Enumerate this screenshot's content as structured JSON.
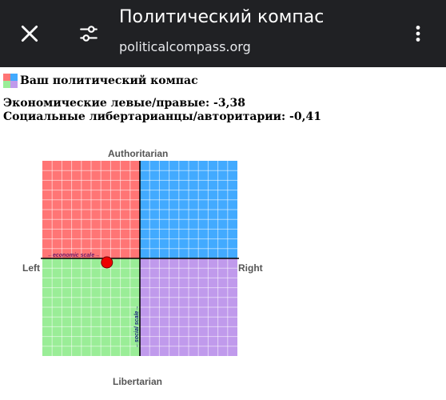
{
  "header": {
    "title": "Политический компас",
    "url": "politicalcompass.org"
  },
  "content": {
    "heading": "Ваш политический компас",
    "economic_line": "Экономические левые/правые: -3,38",
    "social_line": "Социальные либертарианцы/авторитарии: -0,41"
  },
  "compass": {
    "label_top": "Authoritarian",
    "label_bottom": "Libertarian",
    "label_left": "Left",
    "label_right": "Right",
    "economic_scale": "←economic scale→",
    "social_scale": "←social scale→",
    "economic_value": -3.38,
    "social_value": -0.41,
    "range": [
      -10,
      10
    ],
    "colors": {
      "top_left": "#ff7575",
      "top_right": "#42aaff",
      "bottom_left": "#9aed97",
      "bottom_right": "#c09aec",
      "point": "#ee0000"
    }
  },
  "icons": [
    "close-icon",
    "tune-icon",
    "more-vert-icon",
    "favicon-compass-icon"
  ]
}
